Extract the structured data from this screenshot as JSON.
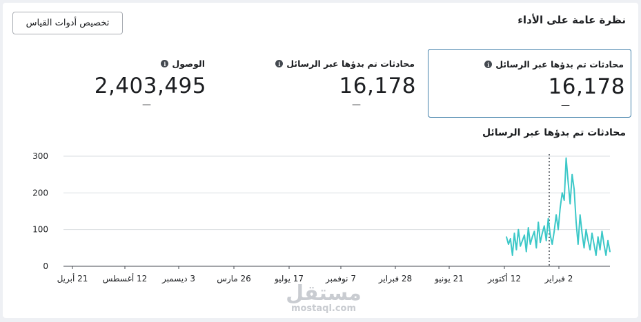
{
  "header": {
    "title": "نظرة عامة على الأداء",
    "customize_label": "تخصيص أدوات القياس"
  },
  "metrics": [
    {
      "label": "محادثات تم بدؤها عبر الرسائل",
      "value": "16,178",
      "change": "—",
      "selected": true
    },
    {
      "label": "محادثات تم بدؤها عبر الرسائل",
      "value": "16,178",
      "change": "—",
      "selected": false
    },
    {
      "label": "الوصول",
      "value": "2,403,495",
      "change": "—",
      "selected": false
    }
  ],
  "info_icon": "info-circle-icon",
  "chart_title": "محادثات تم بدؤها عبر الرسائل",
  "chart_data": {
    "type": "line",
    "title": "محادثات تم بدؤها عبر الرسائل",
    "xlabel": "",
    "ylabel": "",
    "ylim": [
      0,
      300
    ],
    "yticks": [
      "0",
      "100",
      "200",
      "300"
    ],
    "xticks": [
      "21 أبريل",
      "12 أغسطس",
      "3 ديسمبر",
      "26 مارس",
      "17 يوليو",
      "7 نوفمبر",
      "28 فبراير",
      "21 يونيو",
      "12 أكتوبر",
      "2 فبراير"
    ],
    "grid": true,
    "line_color": "#3cc8c8",
    "series": [
      {
        "values": [
          80,
          60,
          75,
          30,
          90,
          45,
          100,
          55,
          70,
          85,
          40,
          105,
          60,
          80,
          95,
          50,
          120,
          65,
          90,
          110,
          70,
          130,
          85,
          60,
          95,
          140,
          100,
          160,
          200,
          180,
          295,
          230,
          170,
          250,
          210,
          120,
          60,
          140,
          90,
          50,
          100,
          70,
          45,
          90,
          60,
          30,
          80,
          45,
          95,
          60,
          30,
          70,
          40
        ]
      }
    ]
  },
  "watermark": {
    "main": "مستقل",
    "sub": "mostaql.com"
  }
}
